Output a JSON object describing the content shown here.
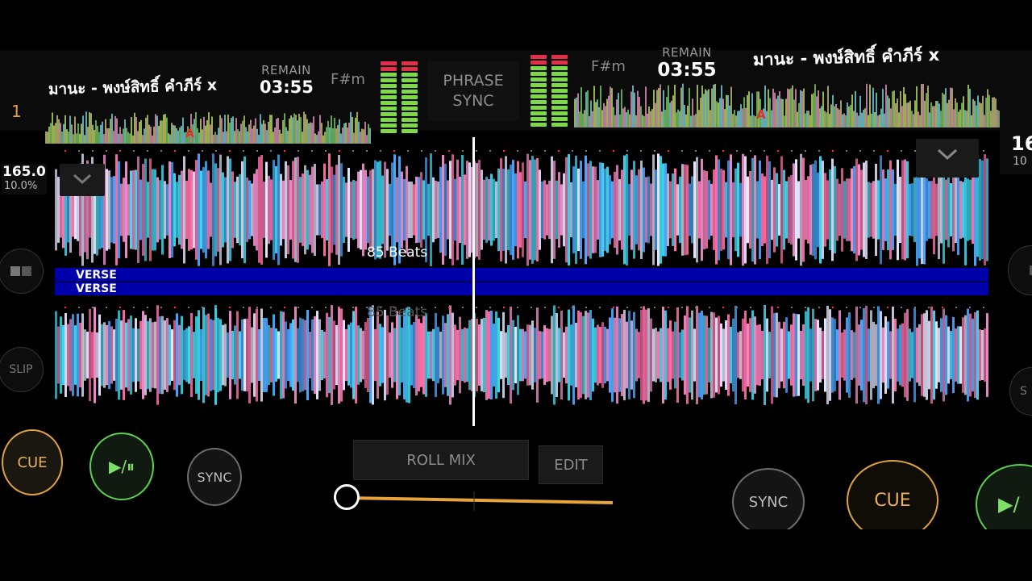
{
  "deck_left": {
    "number": "1",
    "title": "มานะ - พงษ์สิทธิ์ คำภีร์ x",
    "remain_label": "REMAIN",
    "remain_time": "03:55",
    "key": "F#m",
    "bpm": "165.0",
    "pitch": "10.0%",
    "cue_marker": "A",
    "side_buttons": {
      "slip": "SLIP"
    },
    "cue_label": "CUE",
    "play_label": "▶/⏸",
    "sync_label": "SYNC"
  },
  "deck_right": {
    "title": "มานะ - พงษ์สิทธิ์ คำภีร์ x",
    "remain_label": "REMAIN",
    "remain_time": "03:55",
    "key": "F#m",
    "bpm": "16",
    "pitch": "10",
    "cue_marker": "A",
    "side_buttons": {
      "slip": "S"
    },
    "cue_label": "CUE",
    "play_label": "▶/",
    "sync_label": "SYNC"
  },
  "center": {
    "phrase_sync": [
      "PHRASE",
      "SYNC"
    ],
    "roll_mix_label": "ROLL MIX",
    "edit_label": "EDIT",
    "crossfader_value": 0.0
  },
  "waveform": {
    "beats_label": "85 Beats",
    "beats_label_ghost": "85 Beats",
    "phrase_top": "VERSE",
    "phrase_bottom": "VERSE"
  },
  "colors": {
    "accent_orange": "#e8a33a",
    "play_green": "#5fcf4f",
    "phrase_blue": "#0000aa",
    "wave_cyan": "#3fd8f0",
    "wave_pink": "#f08ac8",
    "wave_white": "#e6e6ff"
  },
  "icons": {
    "collapse": "chevron-down-icon",
    "layout": "layout-toggle-icon"
  }
}
